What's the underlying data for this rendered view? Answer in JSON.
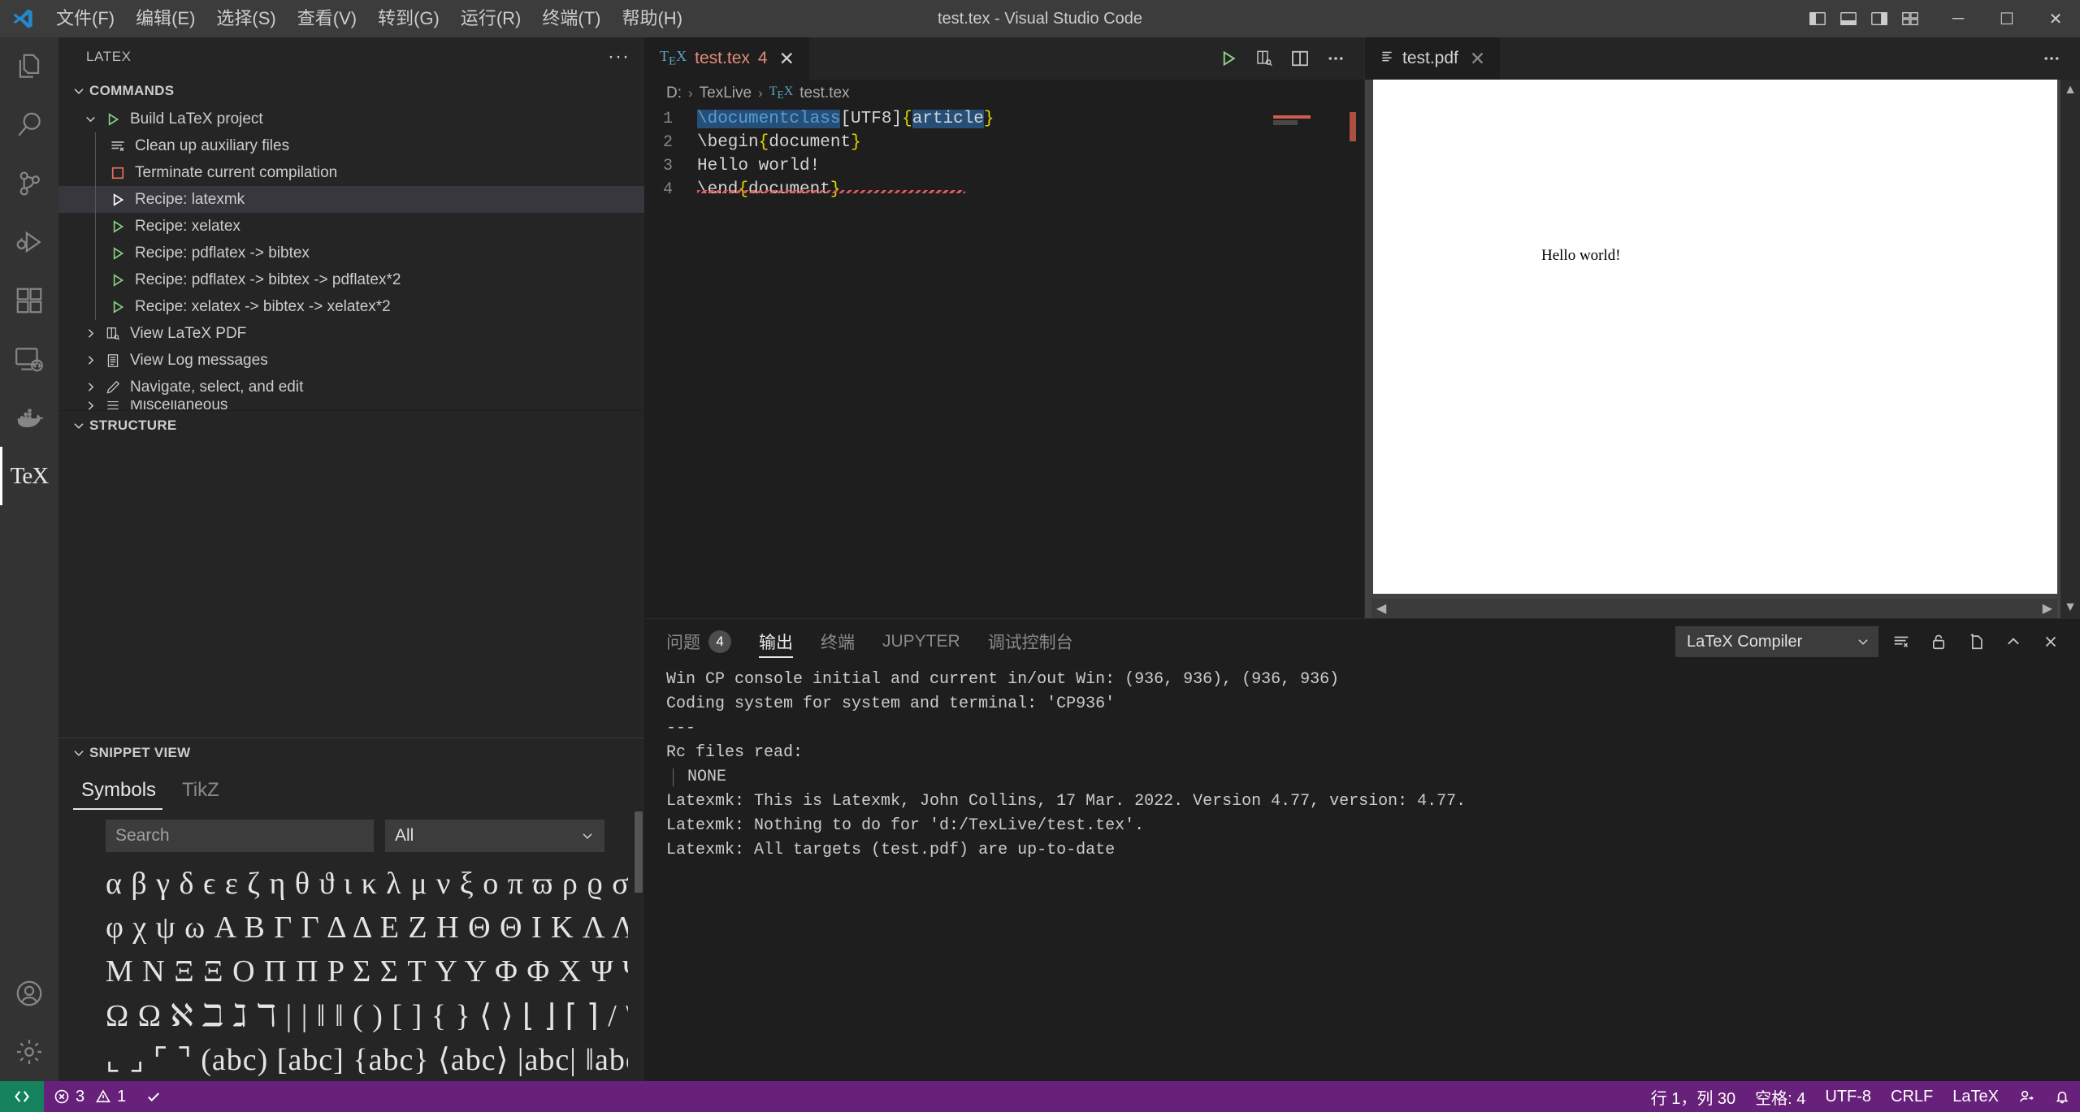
{
  "titlebar": {
    "window_title": "test.tex - Visual Studio Code",
    "logo_icon": "vscode-logo-icon",
    "menus": [
      {
        "label": "文件(F)",
        "name": "menu-file"
      },
      {
        "label": "编辑(E)",
        "name": "menu-edit"
      },
      {
        "label": "选择(S)",
        "name": "menu-selection"
      },
      {
        "label": "查看(V)",
        "name": "menu-view"
      },
      {
        "label": "转到(G)",
        "name": "menu-go"
      },
      {
        "label": "运行(R)",
        "name": "menu-run"
      },
      {
        "label": "终端(T)",
        "name": "menu-terminal"
      },
      {
        "label": "帮助(H)",
        "name": "menu-help"
      }
    ],
    "layout_icons": [
      "toggle-primary-sidebar-icon",
      "toggle-panel-icon",
      "toggle-secondary-sidebar-icon",
      "customize-layout-icon"
    ],
    "window_buttons": {
      "minimize": "─",
      "maximize": "☐",
      "close": "✕"
    }
  },
  "activitybar": {
    "items": [
      {
        "name": "activity-explorer",
        "icon": "files-icon",
        "active": false
      },
      {
        "name": "activity-search",
        "icon": "search-icon",
        "active": false
      },
      {
        "name": "activity-source-control",
        "icon": "source-control-icon",
        "active": false
      },
      {
        "name": "activity-run-debug",
        "icon": "run-and-debug-icon",
        "active": false
      },
      {
        "name": "activity-extensions",
        "icon": "extensions-icon",
        "active": false
      },
      {
        "name": "activity-remote-explorer",
        "icon": "remote-explorer-icon",
        "active": false
      },
      {
        "name": "activity-docker",
        "icon": "docker-whale-icon",
        "active": false
      },
      {
        "name": "activity-latex",
        "icon": "tex-icon",
        "label": "TeX",
        "active": true
      }
    ],
    "bottom_items": [
      {
        "name": "activity-accounts",
        "icon": "account-icon"
      },
      {
        "name": "activity-settings",
        "icon": "gear-icon"
      }
    ]
  },
  "sidebar": {
    "title": "LATEX",
    "more_actions": "···",
    "commands_section": {
      "label": "COMMANDS",
      "expanded": true,
      "items": [
        {
          "label": "Build LaTeX project",
          "icon": "play-green-icon",
          "twisty": "chevron-down",
          "depth": 1,
          "selected": false
        },
        {
          "label": "Clean up auxiliary files",
          "icon": "clean-icon",
          "twisty": "",
          "depth": 2,
          "selected": false
        },
        {
          "label": "Terminate current compilation",
          "icon": "stop-square-icon",
          "twisty": "",
          "depth": 2,
          "selected": false
        },
        {
          "label": "Recipe: latexmk",
          "icon": "play-white-icon",
          "twisty": "",
          "depth": 2,
          "selected": true
        },
        {
          "label": "Recipe: xelatex",
          "icon": "play-green-icon",
          "twisty": "",
          "depth": 2,
          "selected": false
        },
        {
          "label": "Recipe: pdflatex -> bibtex",
          "icon": "play-green-icon",
          "twisty": "",
          "depth": 2,
          "selected": false
        },
        {
          "label": "Recipe: pdflatex -> bibtex -> pdflatex*2",
          "icon": "play-green-icon",
          "twisty": "",
          "depth": 2,
          "selected": false
        },
        {
          "label": "Recipe: xelatex -> bibtex -> xelatex*2",
          "icon": "play-green-icon",
          "twisty": "",
          "depth": 2,
          "selected": false
        },
        {
          "label": "View LaTeX PDF",
          "icon": "pdf-view-icon",
          "twisty": "chevron-right",
          "depth": 1,
          "selected": false
        },
        {
          "label": "View Log messages",
          "icon": "log-icon",
          "twisty": "chevron-right",
          "depth": 1,
          "selected": false
        },
        {
          "label": "Navigate, select, and edit",
          "icon": "pencil-icon",
          "twisty": "chevron-right",
          "depth": 1,
          "selected": false
        },
        {
          "label": "Miscellaneous",
          "icon": "misc-icon",
          "twisty": "chevron-right",
          "depth": 1,
          "selected": false
        }
      ]
    },
    "structure_section": {
      "label": "STRUCTURE",
      "expanded": true
    },
    "snippet_section": {
      "label": "SNIPPET VIEW",
      "expanded": true,
      "tabs": [
        {
          "label": "Symbols",
          "active": true
        },
        {
          "label": "TikZ",
          "active": false
        }
      ],
      "search_placeholder": "Search",
      "filter_value": "All",
      "symbol_rows": [
        "α β γ δ ϵ ε ζ η θ ϑ ι κ λ μ ν ξ ο π ϖ ρ ϱ σ ς τ υ ϕ",
        "φ χ ψ ω A B Γ Γ Δ Δ E Z H Θ Θ I K Λ Λ",
        "M N Ξ Ξ O Π Π P Σ Σ T Υ Υ Φ Φ X Ψ Ψ",
        "Ω Ω ℵ ℶ ℷ ℸ | | ‖ ‖ ( ) [ ] { } ⟨ ⟩ ⌊ ⌋ ⌈ ⌉ / \\ ⇑ ↑ ⇓ ↓",
        "⌞ ⌟ ⌜ ⌝ (abc) [abc] {abc} ⟨abc⟩ |abc| ‖abc‖ ⌊abc⌋"
      ]
    }
  },
  "editor": {
    "tabs": [
      {
        "label": "test.tex",
        "icon": "tex-file-icon",
        "error_count": "4",
        "close": "✕",
        "active": true
      }
    ],
    "tab_actions": [
      "build-latex-project-icon",
      "view-latex-pdf-icon",
      "split-editor-icon",
      "more-actions-icon"
    ],
    "breadcrumb": [
      "D:",
      "TexLive",
      "test.tex"
    ],
    "breadcrumb_separator": "›",
    "lines": [
      {
        "number": "1",
        "text": "\\documentclass[UTF8]{article}"
      },
      {
        "number": "2",
        "text": "\\begin{document}"
      },
      {
        "number": "3",
        "text": "Hello world!"
      },
      {
        "number": "4",
        "text": "\\end{document}"
      }
    ]
  },
  "pdf_viewer": {
    "tab": {
      "label": "test.pdf",
      "icon": "pdf-file-icon",
      "close": "✕"
    },
    "more_actions": "···",
    "page_text": "Hello world!"
  },
  "panel": {
    "tabs": [
      {
        "label": "问题",
        "badge": "4",
        "active": false,
        "name": "tab-problems"
      },
      {
        "label": "输出",
        "badge": "",
        "active": true,
        "name": "tab-output"
      },
      {
        "label": "终端",
        "badge": "",
        "active": false,
        "name": "tab-terminal"
      },
      {
        "label": "JUPYTER",
        "badge": "",
        "active": false,
        "name": "tab-jupyter"
      },
      {
        "label": "调试控制台",
        "badge": "",
        "active": false,
        "name": "tab-debug-console"
      }
    ],
    "channel_select": "LaTeX Compiler",
    "action_icons": [
      "clear-output-icon",
      "unlock-scroll-icon",
      "open-in-editor-icon",
      "maximize-panel-icon",
      "close-panel-icon"
    ],
    "output_lines": [
      {
        "text": "Win CP console initial and current in/out Win: (936, 936), (936, 936)",
        "indented": false
      },
      {
        "text": "Coding system for system and terminal: 'CP936'",
        "indented": false
      },
      {
        "text": "---",
        "indented": false
      },
      {
        "text": "Rc files read:",
        "indented": false
      },
      {
        "text": "NONE",
        "indented": true
      },
      {
        "text": "Latexmk: This is Latexmk, John Collins, 17 Mar. 2022. Version 4.77, version: 4.77.",
        "indented": false
      },
      {
        "text": "Latexmk: Nothing to do for 'd:/TexLive/test.tex'.",
        "indented": false
      },
      {
        "text": "Latexmk: All targets (test.pdf) are up-to-date",
        "indented": false
      }
    ]
  },
  "statusbar": {
    "remote_icon": "remote-window-icon",
    "errors": "3",
    "warnings": "1",
    "check_icon": "check-icon",
    "cursor_position": "行 1，列 30",
    "indentation": "空格: 4",
    "encoding": "UTF-8",
    "eol": "CRLF",
    "language": "LaTeX",
    "feedback_icon": "feedback-icon",
    "bell_icon": "bell-icon"
  },
  "colors": {
    "accent_purple": "#68217a",
    "remote_green": "#16825d",
    "play_green": "#89d185",
    "error_red": "#e28b7c",
    "editor_bg": "#1e1e1e",
    "sidebar_bg": "#252526",
    "titlebar_bg": "#3c3c3c"
  }
}
